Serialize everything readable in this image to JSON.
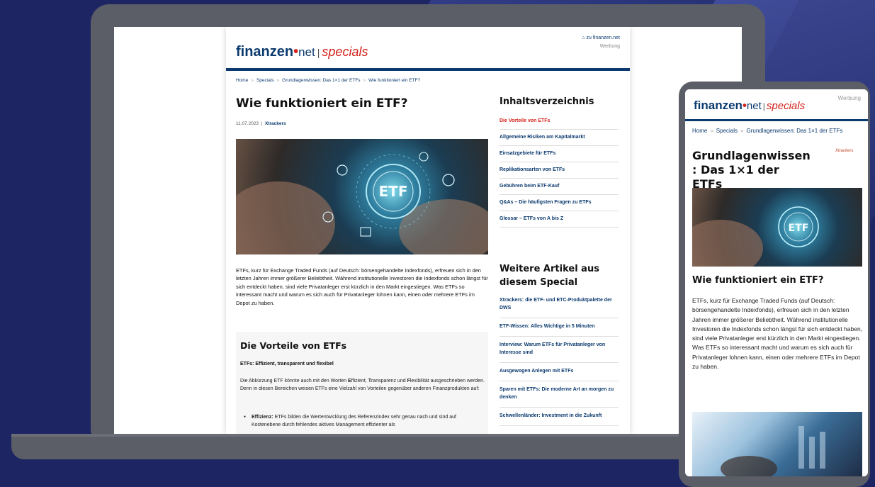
{
  "colors": {
    "navy": "#0b3a6e",
    "red": "#d4221b",
    "device": "#5b5e66",
    "background": "#1d2563"
  },
  "desktop": {
    "logo": {
      "brand": "finanzen",
      "dot": "•",
      "tld": "net",
      "separator": "|",
      "section": "specials"
    },
    "top_link": "⌂ zu finanzen.net",
    "ad_label": "Werbung",
    "breadcrumb": [
      "Home",
      "Specials",
      "Grundlagenwissen: Das 1×1 der ETFs",
      "Wie funktioniert ein ETF?"
    ],
    "breadcrumb_sep": "»",
    "title": "Wie funktioniert ein ETF?",
    "date": "11.07.2023",
    "meta_sep": "|",
    "author": "Xtrackers",
    "hero_label": "ETF",
    "intro": "ETFs, kurz für Exchange Traded Funds (auf Deutsch: börsengehandelte Indexfonds), erfreuen sich in den letzten Jahren immer größerer Beliebtheit. Während institutionelle Investoren die Indexfonds schon längst für sich entdeckt haben, sind viele Privatanleger erst kürzlich in den Markt eingestiegen. Was ETFs so interessant macht und warum es sich auch für Privatanleger lohnen kann, einen oder mehrere ETFs im Depot zu haben.",
    "section_title": "Die Vorteile von ETFs",
    "subsection_title": "ETFs: Effizient, transparent und flexibel",
    "paragraph": {
      "p1": "Die Abkürzung ETF könnte auch mit den Worten ",
      "e": "E",
      "p2": "ffizient, ",
      "t": "T",
      "p3": "ransparenz und ",
      "f": "F",
      "p4": "lexibilität ausgeschrieben werden. Denn in diesen Bereichen weisen ETFs eine Vielzahl von Vorteilen gegenüber anderen Finanzprodukten auf:"
    },
    "bullet_label": "Effizienz:",
    "bullet_text": " ETFs bilden die Wertentwicklung des Referenzindex sehr genau nach und sind auf Kostenebene durch fehlendes aktives Management effizienter als",
    "toc_title": "Inhaltsverzeichnis",
    "toc": [
      "Die Vorteile von ETFs",
      "Allgemeine Risiken am Kapitalmarkt",
      "Einsatzgebiete für ETFs",
      "Replikationsarten von ETFs",
      "Gebühren beim ETF-Kauf",
      "Q&As – Die häufigsten Fragen zu ETFs",
      "Glossar – ETFs von A bis Z"
    ],
    "more_title": "Weitere Artikel aus diesem Special",
    "more": [
      "Xtrackers: die ETF- und ETC-Produktpalette der DWS",
      "ETF-Wissen: Alles Wichtige in 5 Minuten",
      "Interview: Warum ETFs für Privatanleger von Interesse sind",
      "Ausgewogen Anlegen mit ETFs",
      "Sparen mit ETFs: Die moderne Art an morgen zu denken",
      "Schwellenländer: Investment in die Zukunft"
    ]
  },
  "mobile": {
    "ad_label": "Werbung",
    "breadcrumb": [
      "Home",
      "Specials",
      "Grundlagenwissen: Das 1×1 der ETFs"
    ],
    "title": "Grundlagenwissen : Das 1×1 der ETFs",
    "sponsor": "Xtrackers",
    "article_title": "Wie funktioniert ein ETF?",
    "text": "ETFs, kurz für Exchange Traded Funds (auf Deutsch: börsengehandelte Indexfonds), erfreuen sich in den letzten Jahren immer größerer Beliebtheit. Während institutionelle Investoren die Indexfonds schon längst für sich entdeckt haben, sind viele Privatanleger erst kürzlich in den Markt eingestiegen. Was ETFs so interessant macht und warum es sich auch für Privatanleger lohnen kann, einen oder mehrere ETFs im Depot zu haben."
  }
}
